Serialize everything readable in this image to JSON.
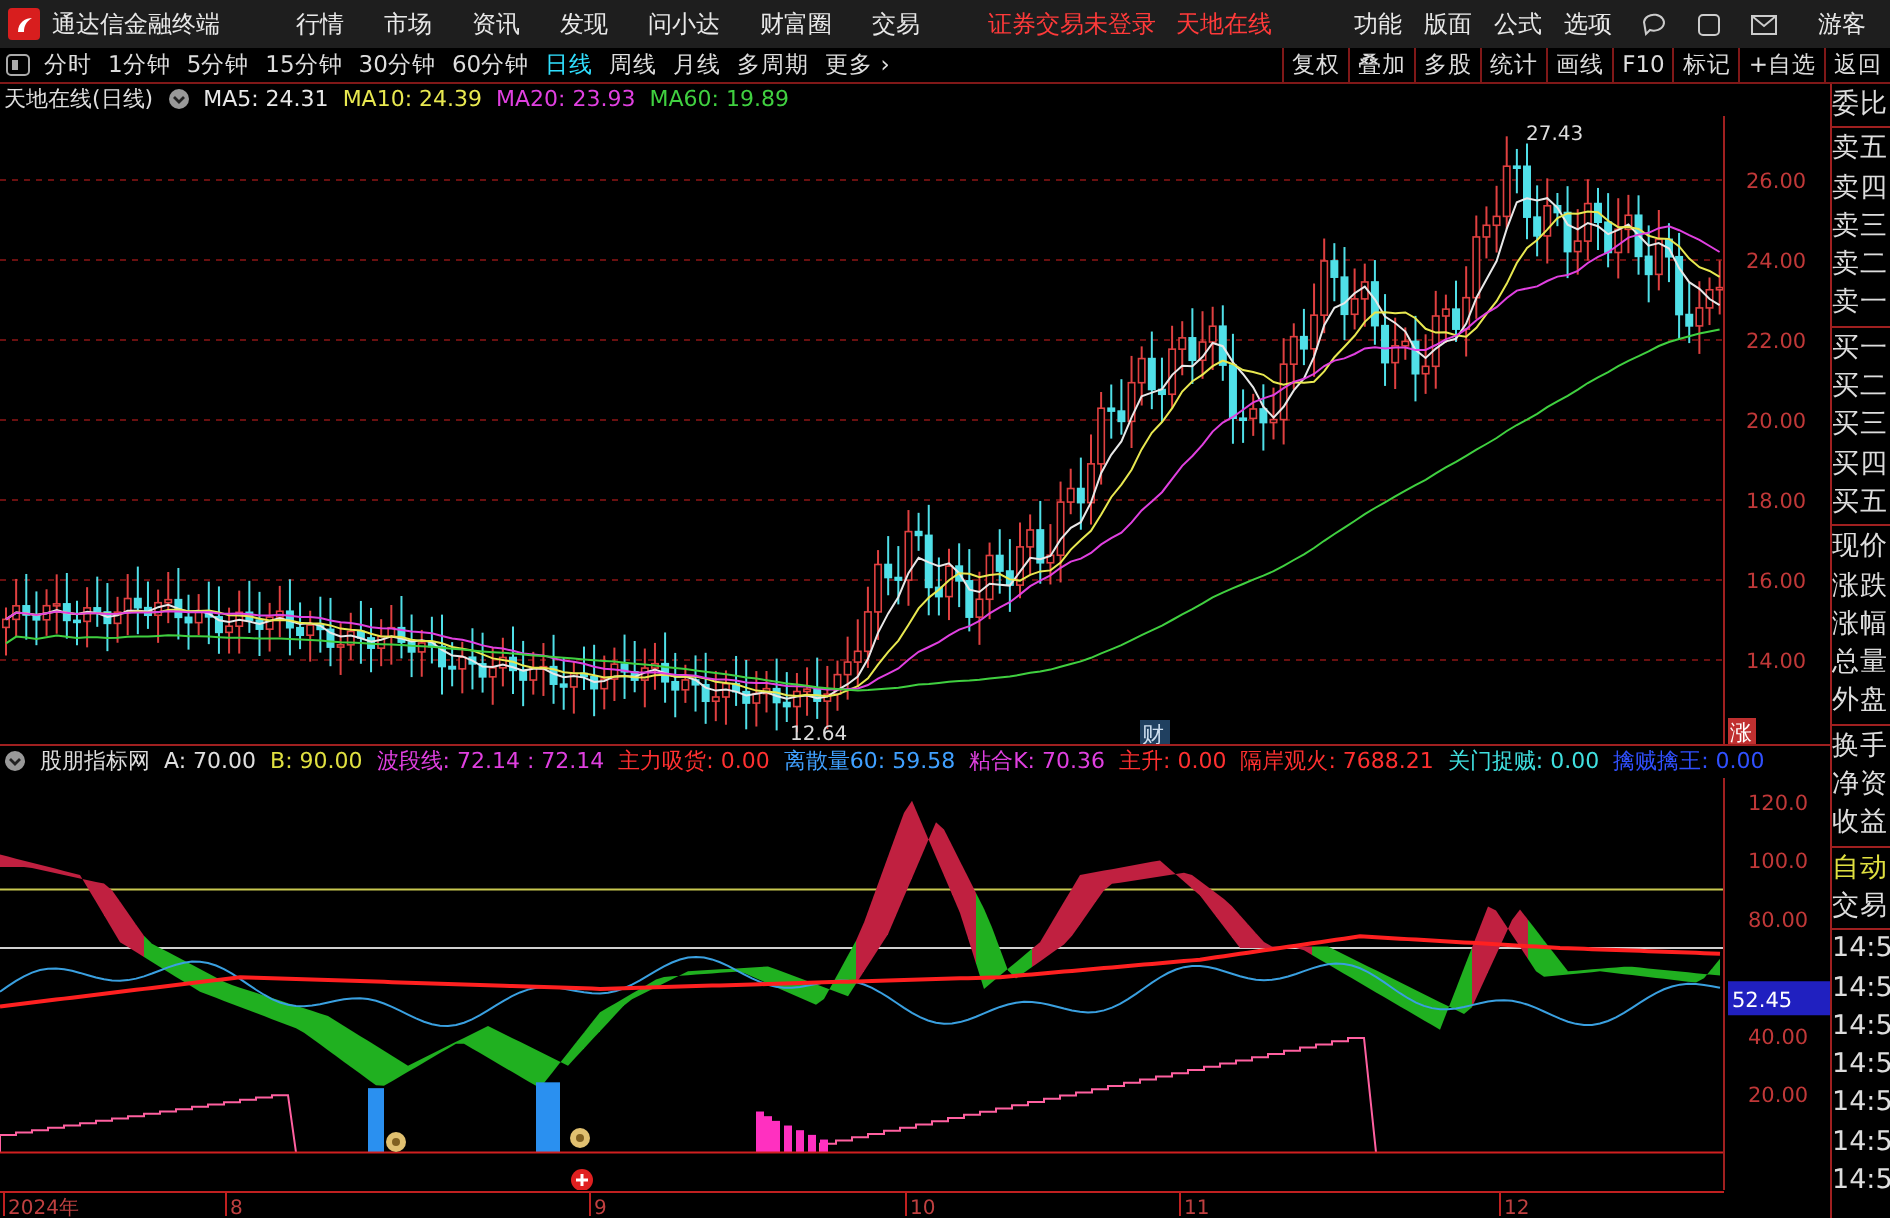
{
  "app_bar": {
    "title": "通达信金融终端",
    "menu": [
      "行情",
      "市场",
      "资讯",
      "发现",
      "问小达",
      "财富圈",
      "交易"
    ],
    "alerts": [
      "证券交易未登录",
      "天地在线"
    ],
    "tools": [
      "功能",
      "版面",
      "公式",
      "选项"
    ],
    "user": "游客"
  },
  "toolbar": {
    "periods": [
      {
        "label": "分时",
        "selected": false
      },
      {
        "label": "1分钟",
        "selected": false
      },
      {
        "label": "5分钟",
        "selected": false
      },
      {
        "label": "15分钟",
        "selected": false
      },
      {
        "label": "30分钟",
        "selected": false
      },
      {
        "label": "60分钟",
        "selected": false
      },
      {
        "label": "日线",
        "selected": true
      },
      {
        "label": "周线",
        "selected": false
      },
      {
        "label": "月线",
        "selected": false
      },
      {
        "label": "多周期",
        "selected": false
      }
    ],
    "more": "更多 ›",
    "actions": [
      "复权",
      "叠加",
      "多股",
      "统计",
      "画线",
      "F10",
      "标记",
      "+自选",
      "返回"
    ]
  },
  "price_panel": {
    "title": "天地在线(日线)",
    "averages": [
      {
        "label": "MA5: 24.31",
        "color": "#e8e8e8"
      },
      {
        "label": "MA10: 24.39",
        "color": "#e8e850"
      },
      {
        "label": "MA20: 23.93",
        "color": "#e040e0"
      },
      {
        "label": "MA60: 19.89",
        "color": "#40d040"
      }
    ],
    "yticks": [
      "26.00",
      "24.00",
      "22.00",
      "20.00",
      "18.00",
      "16.00",
      "14.00"
    ],
    "high_label": "27.43",
    "low_label": "12.64",
    "event_label": "财",
    "badge": "涨"
  },
  "indicator_panel": {
    "name": "股朋指标网",
    "values": [
      {
        "label": "A: 70.00",
        "color": "#e0e0e0"
      },
      {
        "label": "B: 90.00",
        "color": "#e0e040"
      },
      {
        "label": "波段线: 72.14 : 72.14",
        "color": "#e040e0"
      },
      {
        "label": "主力吸货: 0.00",
        "color": "#ff3030"
      },
      {
        "label": "离散量60: 59.58",
        "color": "#40a0ff"
      },
      {
        "label": "粘合K: 70.36",
        "color": "#e040e0"
      },
      {
        "label": "主升: 0.00",
        "color": "#ff3030"
      },
      {
        "label": "隔岸观火: 7688.21",
        "color": "#ff3030"
      },
      {
        "label": "关门捉贼: 0.00",
        "color": "#40e0e0"
      },
      {
        "label": "擒贼擒王: 0.00",
        "color": "#3050ff"
      }
    ],
    "yticks": [
      "120.0",
      "100.0",
      "80.00",
      "40.00",
      "20.00"
    ],
    "current": "52.45"
  },
  "x_axis": [
    "2024年",
    "8",
    "9",
    "10",
    "11",
    "12"
  ],
  "side_panel": {
    "groups": [
      [
        "委比"
      ],
      [
        "卖五",
        "卖四",
        "卖三",
        "卖二",
        "卖一"
      ],
      [
        "买一",
        "买二",
        "买三",
        "买四",
        "买五"
      ],
      [
        "现价",
        "涨跌",
        "涨幅",
        "总量",
        "外盘"
      ],
      [
        "换手",
        "净资",
        "收益"
      ]
    ],
    "auto_trade": [
      "自动",
      "交易"
    ],
    "times": [
      "14:5",
      "14:5",
      "14:5",
      "14:5",
      "14:5",
      "14:5",
      "14:5"
    ]
  }
}
